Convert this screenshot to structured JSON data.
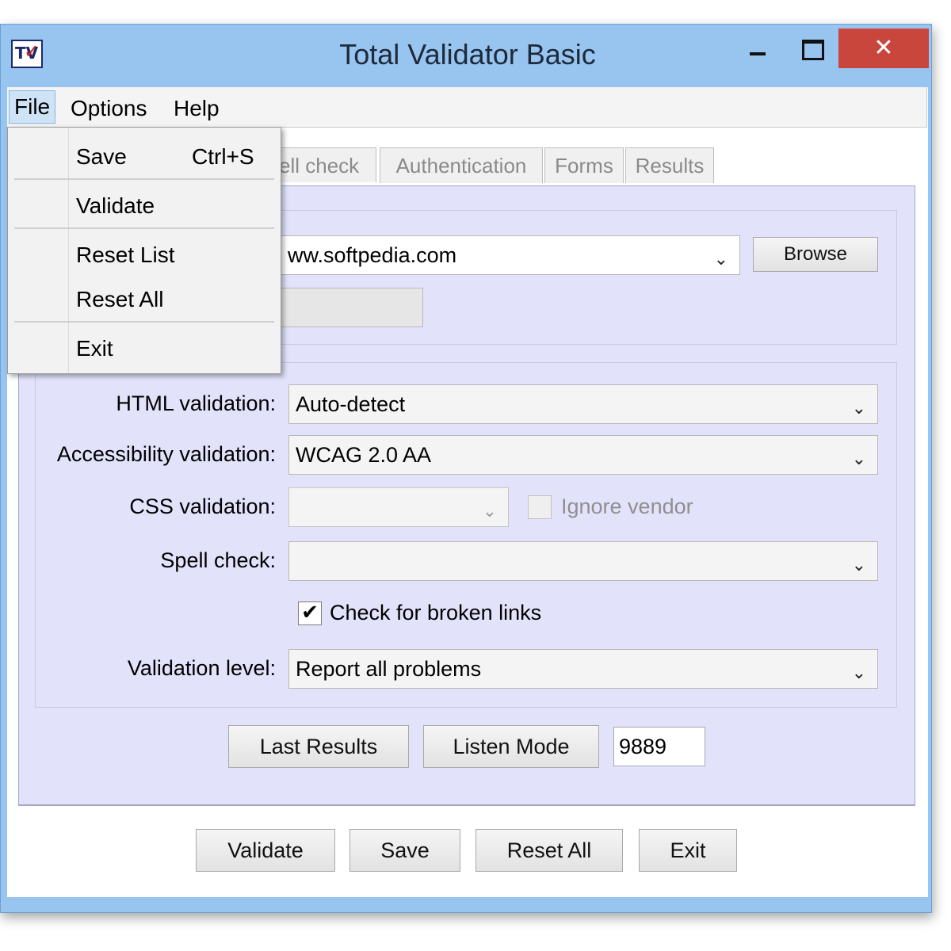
{
  "window": {
    "title": "Total Validator Basic",
    "app_icon": "tv-checkmark-icon",
    "close_symbol": "✕"
  },
  "menubar": {
    "file": "File",
    "options": "Options",
    "help": "Help"
  },
  "file_menu": {
    "items": [
      {
        "label": "Save",
        "shortcut": "Ctrl+S"
      },
      {
        "label": "Validate"
      },
      {
        "label": "Reset List"
      },
      {
        "label": "Reset All"
      },
      {
        "label": "Exit"
      }
    ]
  },
  "tabs": {
    "spell_check": "ell check",
    "authentication": "Authentication",
    "forms": "Forms",
    "results": "Results"
  },
  "url_combo": {
    "value": "ww.softpedia.com"
  },
  "browse_button": "Browse",
  "fields": {
    "html_validation": {
      "label": "HTML validation:",
      "value": "Auto-detect"
    },
    "accessibility_validation": {
      "label": "Accessibility validation:",
      "value": "WCAG 2.0 AA"
    },
    "css_validation": {
      "label": "CSS validation:",
      "value": ""
    },
    "ignore_vendor": {
      "label": "Ignore vendor",
      "checked": false
    },
    "spell_check": {
      "label": "Spell check:",
      "value": ""
    },
    "broken_links": {
      "label": "Check for broken links",
      "checked": true
    },
    "validation_level": {
      "label": "Validation level:",
      "value": "Report all problems"
    }
  },
  "panel_buttons": {
    "last_results": "Last Results",
    "listen_mode": "Listen Mode",
    "port": "9889"
  },
  "bottom_buttons": {
    "validate": "Validate",
    "save": "Save",
    "reset_all": "Reset All",
    "exit": "Exit"
  },
  "colors": {
    "title_bar": "#98c4f0",
    "close_button": "#c9463d",
    "panel_background": "#e2e3fb"
  },
  "glyphs": {
    "chevron": "⌄",
    "check": "✔"
  }
}
